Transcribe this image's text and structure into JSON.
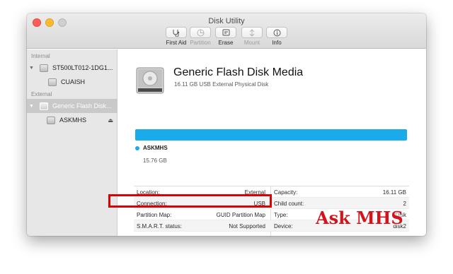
{
  "window": {
    "title": "Disk Utility"
  },
  "toolbar": {
    "buttons": [
      {
        "label": "First Aid",
        "icon": "stethoscope-icon",
        "enabled": true
      },
      {
        "label": "Partition",
        "icon": "pie-icon",
        "enabled": false
      },
      {
        "label": "Erase",
        "icon": "erase-icon",
        "enabled": true
      },
      {
        "label": "Mount",
        "icon": "mount-icon",
        "enabled": false
      },
      {
        "label": "Info",
        "icon": "info-icon",
        "enabled": true
      }
    ]
  },
  "sidebar": {
    "internal_label": "Internal",
    "external_label": "External",
    "internal_disk": "ST500LT012-1DG1...",
    "internal_volume": "CUAISH",
    "external_disk": "Generic Flash Disk...",
    "external_volume": "ASKMHS",
    "eject_symbol": "⏏"
  },
  "disk": {
    "name": "Generic Flash Disk Media",
    "subtitle": "16.11 GB USB External Physical Disk",
    "volume_name": "ASKMHS",
    "volume_size": "15.76 GB",
    "usage_fraction": 1.0,
    "bar_color": "#1aabeb"
  },
  "info": {
    "rows": [
      {
        "left_label": "Location:",
        "left_value": "External",
        "right_label": "Capacity:",
        "right_value": "16.11 GB"
      },
      {
        "left_label": "Connection:",
        "left_value": "USB",
        "right_label": "Child count:",
        "right_value": "2"
      },
      {
        "left_label": "Partition Map:",
        "left_value": "GUID Partition Map",
        "right_label": "Type:",
        "right_value": "Disk"
      },
      {
        "left_label": "S.M.A.R.T. status:",
        "left_value": "Not Supported",
        "right_label": "Device:",
        "right_value": "disk2"
      }
    ]
  },
  "watermark": {
    "text": "Ask MHS",
    "color": "#d4141c"
  },
  "annotation": {
    "highlight_color": "#e00000"
  }
}
